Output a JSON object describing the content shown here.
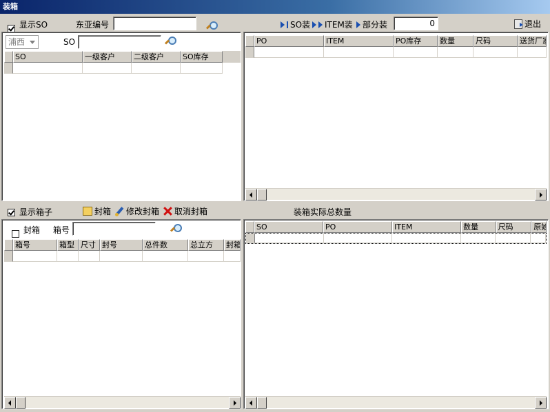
{
  "window": {
    "title": "装箱"
  },
  "top_toolbar": {
    "show_so_label": "显示SO",
    "show_so_checked": true,
    "dongya_no_label": "东亚编号",
    "dongya_no_value": "",
    "so_pack_label": "SO装",
    "item_pack_label": "ITEM装",
    "partial_pack_label": "部分装",
    "partial_qty_value": "0",
    "exit_label": "退出"
  },
  "so_panel": {
    "combo_value": "浦西",
    "so_label": "SO",
    "so_value": "",
    "columns": [
      "SO",
      "一级客户",
      "二级客户",
      "SO库存"
    ]
  },
  "po_panel": {
    "columns": [
      "PO",
      "ITEM",
      "PO库存",
      "数量",
      "尺码",
      "送货厂家"
    ]
  },
  "box_toolbar": {
    "show_box_label": "显示箱子",
    "show_box_checked": true,
    "seal_label": "封箱",
    "modify_seal_label": "修改封箱",
    "cancel_seal_label": "取消封箱",
    "total_qty_label": "装箱实际总数量"
  },
  "box_panel": {
    "sealed_label": "封箱",
    "sealed_checked": false,
    "box_no_label": "箱号",
    "box_no_value": "",
    "columns": [
      "箱号",
      "箱型",
      "尺寸",
      "封号",
      "总件数",
      "总立方",
      "封箱"
    ]
  },
  "detail_panel": {
    "columns": [
      "SO",
      "PO",
      "ITEM",
      "数量",
      "尺码",
      "原始"
    ]
  }
}
